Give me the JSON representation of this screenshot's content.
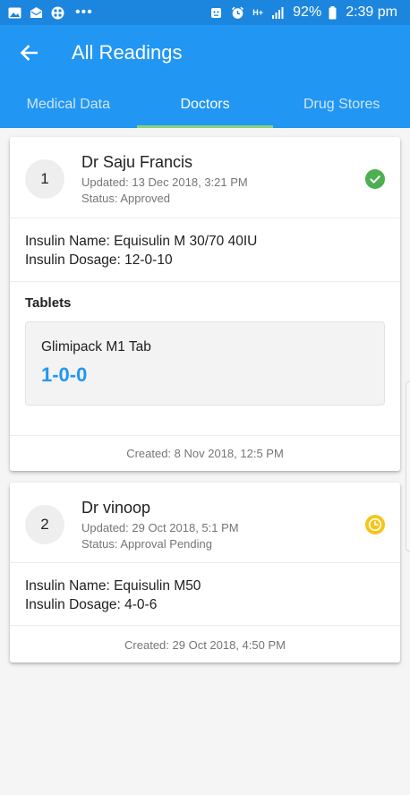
{
  "status_bar": {
    "left_icons": [
      "image-icon",
      "mail-icon",
      "grid-app-icon"
    ],
    "more": "•••",
    "right_icons": [
      "face-icon",
      "alarm-icon",
      "hplus-icon",
      "signal-icon"
    ],
    "network": "H+",
    "battery": "92%",
    "time": "2:39 pm"
  },
  "app_bar": {
    "title": "All Readings",
    "back_icon": "arrow-left-icon"
  },
  "tabs": [
    {
      "label": "Medical Data",
      "active": false
    },
    {
      "label": "Doctors",
      "active": true
    },
    {
      "label": "Drug Stores",
      "active": false
    }
  ],
  "colors": {
    "primary": "#2196f3",
    "status_bar": "#1c86df",
    "tab_indicator": "#8bd17c",
    "approved": "#4caf50",
    "pending": "#f5c518",
    "dose": "#2196f3"
  },
  "doctors": [
    {
      "index": "1",
      "name": "Dr Saju Francis",
      "updated": "Updated: 13 Dec 2018, 3:21 PM",
      "status": "Status: Approved",
      "status_icon": "check-circle-icon",
      "insulin_name": "Insulin Name: Equisulin M 30/70 40IU",
      "insulin_dosage": "Insulin Dosage: 12-0-10",
      "tablets_title": "Tablets",
      "tablet_name": "Glimipack M1 Tab",
      "tablet_dose": "1-0-0",
      "created": "Created: 8 Nov 2018, 12:5 PM"
    },
    {
      "index": "2",
      "name": "Dr vinoop",
      "updated": "Updated: 29 Oct 2018, 5:1 PM",
      "status": "Status: Approval Pending",
      "status_icon": "clock-circle-icon",
      "insulin_name": "Insulin Name: Equisulin M50",
      "insulin_dosage": "Insulin Dosage: 4-0-6",
      "created": "Created: 29 Oct 2018, 4:50 PM"
    }
  ]
}
